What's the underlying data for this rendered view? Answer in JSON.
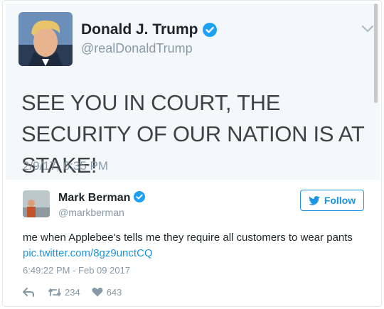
{
  "quoted_tweet": {
    "author_name": "Donald J. Trump",
    "handle": "@realDonaldTrump",
    "text": "SEE YOU IN COURT, THE SECURITY OF OUR NATION IS AT STAKE!",
    "timestamp": "2/9/17, 6:35 PM"
  },
  "tweet": {
    "author_name": "Mark Berman",
    "handle": "@markberman",
    "follow_label": "Follow",
    "text": "me when Applebee's tells me they require all customers to wear pants",
    "link": "pic.twitter.com/8gz9unctCQ",
    "timestamp": "6:49:22 PM - Feb 09 2017",
    "retweet_count": "234",
    "like_count": "643"
  },
  "colors": {
    "accent": "#1b95e0",
    "verified": "#1da1f2",
    "muted": "#8899a6"
  },
  "icons": [
    "verified-icon",
    "chevron-down-icon",
    "twitter-bird-icon",
    "reply-icon",
    "retweet-icon",
    "heart-icon"
  ]
}
